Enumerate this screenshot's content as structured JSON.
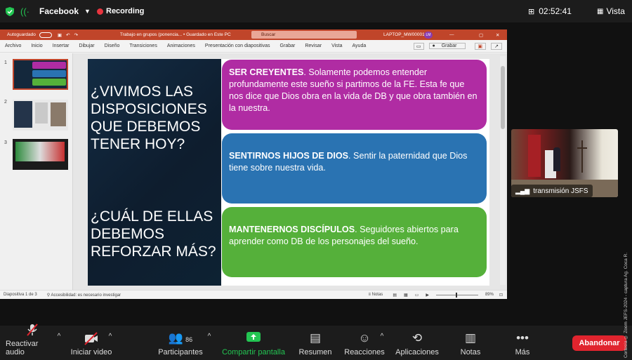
{
  "topbar": {
    "app_name": "Facebook",
    "recording_label": "Recording",
    "clock": "02:52:41",
    "view_label": "Vista"
  },
  "ppt": {
    "autosave_label": "Autoguardado",
    "doc_title": "Trabajo en grupos (ponencia... • Guardado en Este PC",
    "search_placeholder": "Buscar",
    "device": "LAPTOP_MW00001",
    "user_initials": "LM",
    "menu": [
      "Archivo",
      "Inicio",
      "Insertar",
      "Dibujar",
      "Diseño",
      "Transiciones",
      "Animaciones",
      "Presentación con diapositivas",
      "Grabar",
      "Revisar",
      "Vista",
      "Ayuda"
    ],
    "record_button": "Grabar",
    "thumbnails": [
      {
        "num": "1"
      },
      {
        "num": "2"
      },
      {
        "num": "3"
      }
    ],
    "status_slide": "Diapositiva 1 de 3",
    "status_accessibility": "Accesibilidad: es necesario investigar",
    "status_notes": "Notas",
    "zoom": "89%"
  },
  "slide": {
    "question1": "¿VIVIMOS LAS\nDISPOSICIONES\nQUE DEBEMOS\nTENER HOY?",
    "question2": "¿CUÁL DE ELLAS\nDEBEMOS\nREFORZAR MÁS?",
    "cards": [
      {
        "bold": "SER CREYENTES",
        "text": ". Solamente podemos entender profundamente este sueño si partimos de la FE. Esta fe que nos dice que Dios obra en la vida de DB y que obra también en la nuestra.",
        "color": "#b02ca3"
      },
      {
        "bold": "SENTIRNOS HIJOS DE DIOS",
        "text": ". Sentir la paternidad que Dios tiene sobre nuestra vida.",
        "color": "#2a73b2"
      },
      {
        "bold": "MANTENERNOS DISCÍPULOS",
        "text": ". Seguidores abiertos para aprender como DB de los personajes del sueño.",
        "color": "#55b03a"
      }
    ]
  },
  "camera": {
    "label": "transmisión JSFS"
  },
  "controls": [
    {
      "label": "Reactivar audio",
      "icon": "microphone-muted-icon"
    },
    {
      "label": "Iniciar video",
      "icon": "camera-off-icon"
    },
    {
      "label": "Participantes",
      "icon": "participants-icon",
      "count": "86"
    },
    {
      "label": "Compartir pantalla",
      "icon": "share-screen-icon"
    },
    {
      "label": "Resumen",
      "icon": "summary-icon"
    },
    {
      "label": "Reacciones",
      "icon": "reactions-icon"
    },
    {
      "label": "Aplicaciones",
      "icon": "apps-icon"
    },
    {
      "label": "Notas",
      "icon": "notes-icon"
    },
    {
      "label": "Más",
      "icon": "more-icon"
    }
  ],
  "leave_label": "Abandonar",
  "credit": "Cortesía © Zoom JEFS-2024 - captura Ag. Coca R.",
  "colors": {
    "share_green": "#23c552",
    "leave_red": "#e0242e",
    "ppt_red": "#c0452a"
  }
}
